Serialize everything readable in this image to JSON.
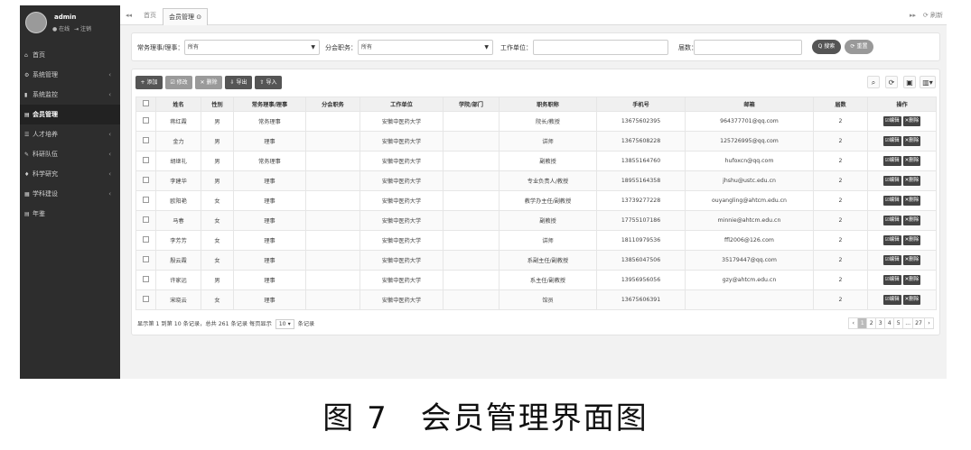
{
  "user": {
    "name": "admin",
    "online": "● 在线",
    "logout": "⇥ 注销"
  },
  "sidebar": {
    "items": [
      {
        "icon": "⌂",
        "label": "首页",
        "arrow": ""
      },
      {
        "icon": "⚙",
        "label": "系统管理",
        "arrow": "‹"
      },
      {
        "icon": "▮",
        "label": "系统监控",
        "arrow": "‹"
      },
      {
        "icon": "▤",
        "label": "会员管理",
        "arrow": ""
      },
      {
        "icon": "☰",
        "label": "人才培养",
        "arrow": "‹"
      },
      {
        "icon": "✎",
        "label": "科研队伍",
        "arrow": "‹"
      },
      {
        "icon": "♦",
        "label": "科学研究",
        "arrow": "‹"
      },
      {
        "icon": "▦",
        "label": "学科建设",
        "arrow": "‹"
      },
      {
        "icon": "▤",
        "label": "年鉴",
        "arrow": ""
      }
    ]
  },
  "topbar": {
    "back": "◂◂",
    "home_tab": "首页",
    "active_tab": "会员管理 ⊙",
    "forward": "▸▸",
    "refresh": "⟳ 刷新"
  },
  "search": {
    "role_label": "常务理事/理事：",
    "role_value": "所有",
    "branch_label": "分会职务：",
    "branch_value": "所有",
    "work_label": "工作单位：",
    "work_placeholder": "",
    "batch_label": "届数：",
    "batch_placeholder": "",
    "search_btn": "Q 搜索",
    "reset_btn": "⟳ 重置"
  },
  "toolbar": {
    "add": "+ 添加",
    "edit": "☑ 修改",
    "delete": "✕ 删除",
    "export": "⇩ 导出",
    "import": "⇧ 导入"
  },
  "table": {
    "headers": [
      "",
      "姓名",
      "性别",
      "常务理事/理事",
      "分会职务",
      "工作单位",
      "学院/部门",
      "职务职称",
      "手机号",
      "邮箱",
      "届数",
      "操作"
    ],
    "rows": [
      [
        "蒋红霞",
        "男",
        "常务理事",
        "",
        "安徽中医药大学",
        "",
        "院长/教授",
        "13675602395",
        "964377701@qq.com",
        "2"
      ],
      [
        "金力",
        "男",
        "理事",
        "",
        "安徽中医药大学",
        "",
        "讲师",
        "13675608228",
        "125726995@qq.com",
        "2"
      ],
      [
        "胡继礼",
        "男",
        "常务理事",
        "",
        "安徽中医药大学",
        "",
        "副教授",
        "13855164760",
        "hufoxcn@qq.com",
        "2"
      ],
      [
        "李建华",
        "男",
        "理事",
        "",
        "安徽中医药大学",
        "",
        "专业负责人/教授",
        "18955164358",
        "jhshu@ustc.edu.cn",
        "2"
      ],
      [
        "欧阳艳",
        "女",
        "理事",
        "",
        "安徽中医药大学",
        "",
        "教学办主任/副教授",
        "13739277228",
        "ouyangling@ahtcm.edu.cn",
        "2"
      ],
      [
        "马春",
        "女",
        "理事",
        "",
        "安徽中医药大学",
        "",
        "副教授",
        "17755107186",
        "minnie@ahtcm.edu.cn",
        "2"
      ],
      [
        "李芳芳",
        "女",
        "理事",
        "",
        "安徽中医药大学",
        "",
        "讲师",
        "18110979536",
        "ffl2006@126.com",
        "2"
      ],
      [
        "殷云霞",
        "女",
        "理事",
        "",
        "安徽中医药大学",
        "",
        "系副主任/副教授",
        "13856047506",
        "35179447@qq.com",
        "2"
      ],
      [
        "许家远",
        "男",
        "理事",
        "",
        "安徽中医药大学",
        "",
        "系主任/副教授",
        "13956956056",
        "gzy@ahtcm.edu.cn",
        "2"
      ],
      [
        "宋晓云",
        "女",
        "理事",
        "",
        "安徽中医药大学",
        "",
        "馆员",
        "13675606391",
        "",
        "2"
      ]
    ],
    "op_edit": "☑编辑",
    "op_delete": "✕删除"
  },
  "pager": {
    "info_prefix": "显示第 1 到第 10 条记录，总共 261 条记录 每页显示",
    "page_size": "10 ▾",
    "info_suffix": "条记录",
    "pages": [
      "‹",
      "1",
      "2",
      "3",
      "4",
      "5",
      "...",
      "27",
      "›"
    ]
  },
  "caption": "图 7　会员管理界面图"
}
